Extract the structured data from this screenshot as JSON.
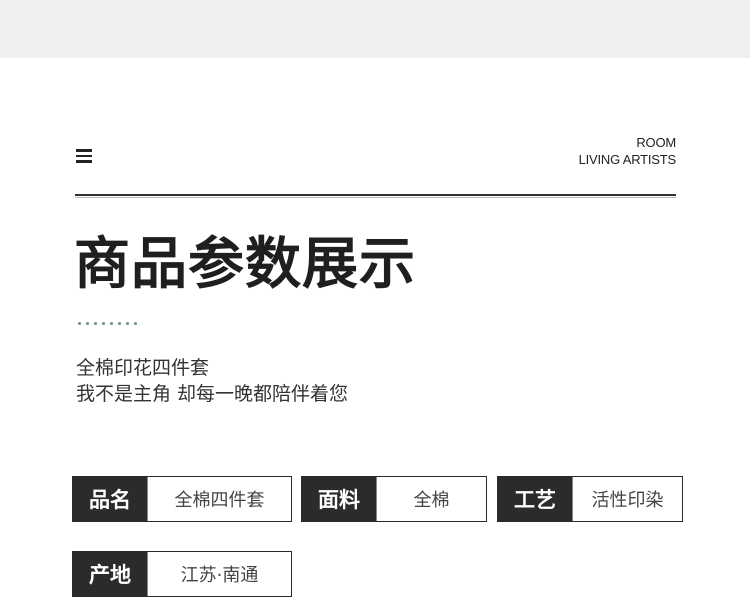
{
  "header": {
    "brand_line1": "ROOM",
    "brand_line2": "LIVING ARTISTS",
    "menu_icon": "hamburger-menu-icon"
  },
  "main": {
    "title": "商品参数展示",
    "subtitle_line1": "全棉印花四件套",
    "subtitle_line2": "我不是主角 却每一晚都陪伴着您"
  },
  "specs": [
    {
      "label": "品名",
      "value": "全棉四件套"
    },
    {
      "label": "面料",
      "value": "全棉"
    },
    {
      "label": "工艺",
      "value": "活性印染"
    },
    {
      "label": "产地",
      "value": "江苏·南通"
    }
  ],
  "colors": {
    "accent_dots": "#6b8f8a",
    "label_bg": "#2b2b2b",
    "top_band": "#efefef"
  }
}
